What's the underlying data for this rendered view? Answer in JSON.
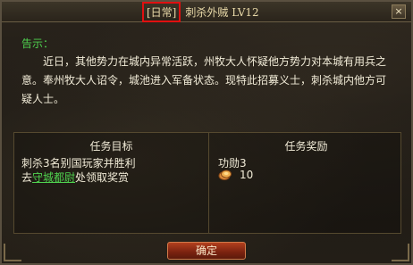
{
  "window": {
    "title_tag": "[日常]",
    "title_text": "刺杀外贼 LV12",
    "close_label": "×"
  },
  "notice": {
    "label": "告示："
  },
  "body_text": "近日，其他势力在城内异常活跃，州牧大人怀疑他方势力对本城有用兵之意。奉州牧大人诏令，城池进入军备状态。现特此招募义士，刺杀城内他方可疑人士。",
  "quest_goal": {
    "header": "任务目标",
    "line1": "刺杀3名别国玩家并胜利",
    "line2_prefix": "去",
    "line2_npc": "守城都尉",
    "line2_suffix": "处领取奖赏"
  },
  "quest_reward": {
    "header": "任务奖励",
    "merit": "功勋3",
    "money_value": "10",
    "money_icon": "coin-icon"
  },
  "buttons": {
    "confirm_label": "确定"
  },
  "colors": {
    "accent_green": "#4fd24f",
    "highlight_red": "#e01010",
    "text_main": "#f2ecd8",
    "button_red": "#b3401e"
  }
}
